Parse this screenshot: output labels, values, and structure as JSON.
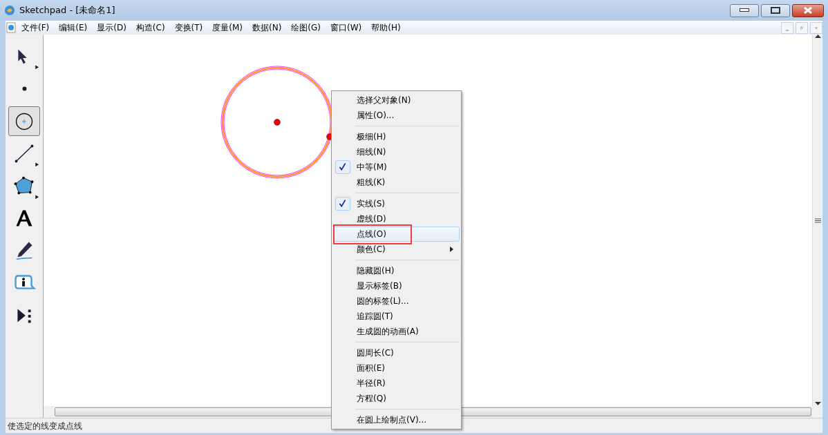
{
  "window": {
    "title": "Sketchpad  - [未命名1]"
  },
  "menu_bar": [
    "文件(F)",
    "编辑(E)",
    "显示(D)",
    "构造(C)",
    "变换(T)",
    "度量(M)",
    "数据(N)",
    "绘图(G)",
    "窗口(W)",
    "帮助(H)"
  ],
  "toolbox": [
    {
      "kind": "arrow",
      "selected": false
    },
    {
      "kind": "point",
      "selected": false
    },
    {
      "kind": "compass",
      "selected": true
    },
    {
      "kind": "line",
      "selected": false
    },
    {
      "kind": "polygon",
      "selected": false
    },
    {
      "kind": "text",
      "selected": false
    },
    {
      "kind": "marker",
      "selected": false
    },
    {
      "kind": "info",
      "selected": false
    },
    {
      "kind": "custom",
      "selected": false
    }
  ],
  "context_menu": {
    "sections": [
      [
        {
          "label": "选择父对象(N)",
          "checked": false,
          "selected": false
        },
        {
          "label": "属性(O)...",
          "checked": false,
          "selected": false
        }
      ],
      [
        {
          "label": "极细(H)",
          "checked": false,
          "selected": false
        },
        {
          "label": "细线(N)",
          "checked": false,
          "selected": false
        },
        {
          "label": "中等(M)",
          "checked": true,
          "selected": false
        },
        {
          "label": "粗线(K)",
          "checked": false,
          "selected": false
        }
      ],
      [
        {
          "label": "实线(S)",
          "checked": true,
          "selected": false
        },
        {
          "label": "虚线(D)",
          "checked": false,
          "selected": false
        },
        {
          "label": "点线(O)",
          "checked": false,
          "selected": true
        },
        {
          "label": "颜色(C)",
          "checked": false,
          "selected": false,
          "submenu": true
        }
      ],
      [
        {
          "label": "隐藏圆(H)",
          "checked": false,
          "selected": false
        },
        {
          "label": "显示标签(B)",
          "checked": false,
          "selected": false
        },
        {
          "label": "圆的标签(L)...",
          "checked": false,
          "selected": false
        },
        {
          "label": "追踪圆(T)",
          "checked": false,
          "selected": false
        },
        {
          "label": "生成圆的动画(A)",
          "checked": false,
          "selected": false
        }
      ],
      [
        {
          "label": "圆周长(C)",
          "checked": false,
          "selected": false
        },
        {
          "label": "面积(E)",
          "checked": false,
          "selected": false
        },
        {
          "label": "半径(R)",
          "checked": false,
          "selected": false
        },
        {
          "label": "方程(Q)",
          "checked": false,
          "selected": false
        }
      ],
      [
        {
          "label": "在圆上绘制点(V)...",
          "checked": false,
          "selected": false
        }
      ]
    ]
  },
  "status_bar": "使选定的线变成点线"
}
